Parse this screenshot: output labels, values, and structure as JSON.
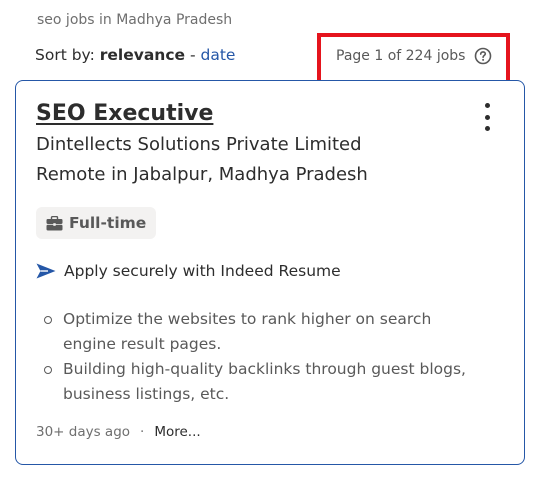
{
  "search": {
    "heading": "seo jobs in Madhya Pradesh"
  },
  "sort": {
    "label": "Sort by:",
    "current": "relevance",
    "separator": "-",
    "alternative": "date"
  },
  "pagination": {
    "text": "Page 1 of 224 jobs",
    "help_icon": "question-circle-icon",
    "highlight_color": "#e5141d"
  },
  "job": {
    "title": "SEO Executive",
    "company": "Dintellects Solutions Private Limited",
    "location": "Remote in Jabalpur, Madhya Pradesh",
    "job_type": "Full-time",
    "job_type_icon": "briefcase-icon",
    "apply_note": "Apply securely with Indeed Resume",
    "apply_icon": "send-arrow-icon",
    "snippet": [
      "Optimize the websites to rank higher on search engine result pages.",
      "Building high-quality backlinks through guest blogs, business listings, etc."
    ],
    "posted": "30+ days ago",
    "footer_separator": "·",
    "more_label": "More...",
    "menu_icon": "more-options-icon"
  },
  "colors": {
    "accent": "#2557a7",
    "text": "#2d2d2d",
    "muted": "#6f6f6f"
  }
}
